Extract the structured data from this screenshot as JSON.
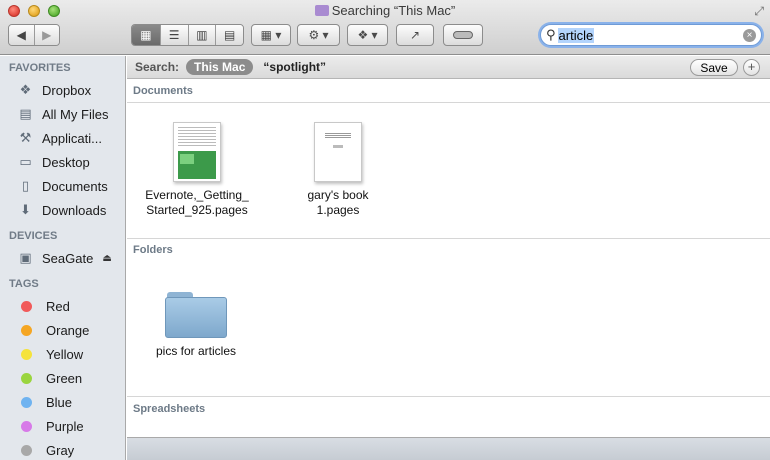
{
  "window": {
    "title": "Searching “This Mac”"
  },
  "toolbar": {
    "back_icon": "chevron-left-icon",
    "forward_icon": "chevron-right-icon",
    "view_modes": [
      "icon-view",
      "list-view",
      "column-view",
      "cover-flow-view"
    ],
    "active_view": "icon-view"
  },
  "search": {
    "value": "article"
  },
  "sidebar": {
    "favorites_header": "FAVORITES",
    "favorites": [
      {
        "label": "Dropbox",
        "icon": "dropbox-icon"
      },
      {
        "label": "All My Files",
        "icon": "all-files-icon"
      },
      {
        "label": "Applicati...",
        "icon": "applications-icon"
      },
      {
        "label": "Desktop",
        "icon": "desktop-icon"
      },
      {
        "label": "Documents",
        "icon": "documents-icon"
      },
      {
        "label": "Downloads",
        "icon": "downloads-icon"
      }
    ],
    "devices_header": "DEVICES",
    "devices": [
      {
        "label": "SeaGate",
        "icon": "drive-icon"
      }
    ],
    "tags_header": "TAGS",
    "tags": [
      {
        "label": "Red",
        "color": "#f15a5a"
      },
      {
        "label": "Orange",
        "color": "#f5a623"
      },
      {
        "label": "Yellow",
        "color": "#f5e33b"
      },
      {
        "label": "Green",
        "color": "#9ad53f"
      },
      {
        "label": "Blue",
        "color": "#6fb3f0"
      },
      {
        "label": "Purple",
        "color": "#d77ae8"
      },
      {
        "label": "Gray",
        "color": "#a8a8a8"
      }
    ]
  },
  "scope": {
    "label": "Search:",
    "selected": "This Mac",
    "other": "“spotlight”",
    "save_label": "Save",
    "add_label": "+"
  },
  "groups": {
    "documents": {
      "header": "Documents",
      "items": [
        {
          "name_line1": "Evernote,_Getting_",
          "name_line2": "Started_925.pages"
        },
        {
          "name_line1": "gary's book",
          "name_line2": "1.pages"
        }
      ]
    },
    "folders": {
      "header": "Folders",
      "items": [
        {
          "name": "pics for articles"
        }
      ]
    },
    "spreadsheets": {
      "header": "Spreadsheets"
    }
  }
}
